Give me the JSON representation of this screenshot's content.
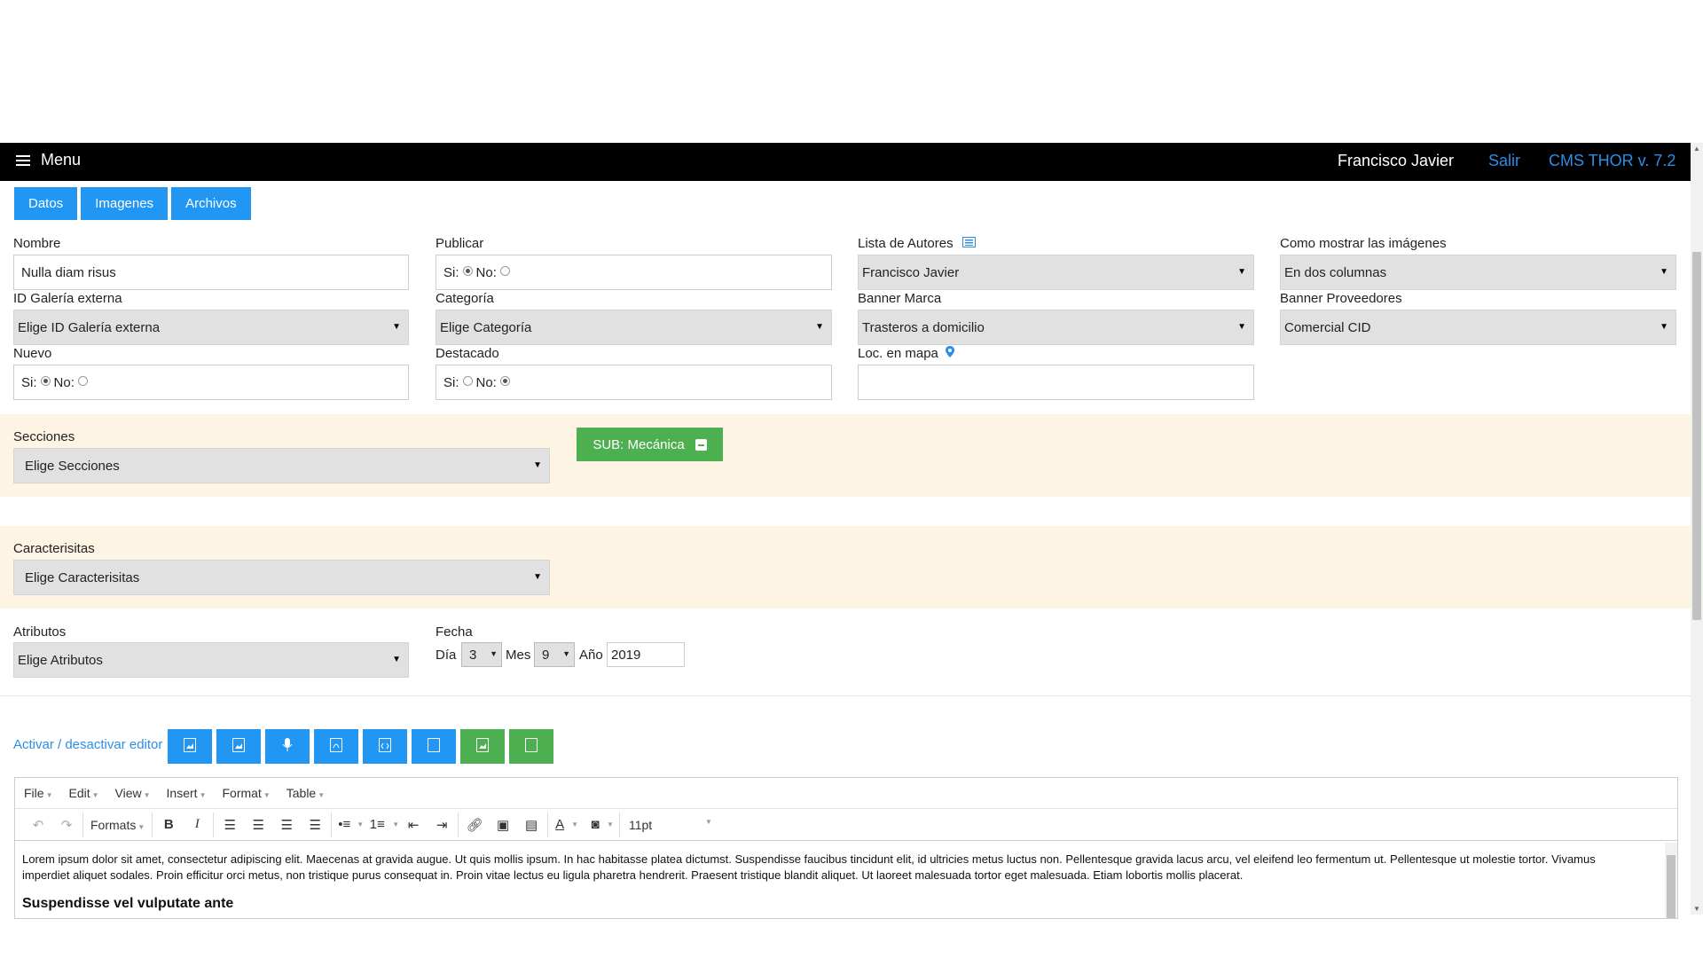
{
  "header": {
    "menu_label": "Menu",
    "user": "Francisco Javier",
    "logout": "Salir",
    "version": "CMS THOR v. 7.2"
  },
  "tabs": [
    "Datos",
    "Imagenes",
    "Archivos"
  ],
  "form": {
    "nombre": {
      "label": "Nombre",
      "value": "Nulla diam risus"
    },
    "publicar": {
      "label": "Publicar",
      "yes": "Si:",
      "no": "No:",
      "selected": "si"
    },
    "autores": {
      "label": "Lista de Autores",
      "value": "Francisco Javier"
    },
    "mostrar_imagenes": {
      "label": "Como mostrar las imágenes",
      "value": "En dos columnas"
    },
    "galeria": {
      "label": "ID Galería externa",
      "value": "Elige ID Galería externa"
    },
    "categoria": {
      "label": "Categoría",
      "value": "Elige Categoría"
    },
    "banner_marca": {
      "label": "Banner Marca",
      "value": "Trasteros a domicilio"
    },
    "banner_proveedores": {
      "label": "Banner Proveedores",
      "value": "Comercial CID"
    },
    "nuevo": {
      "label": "Nuevo",
      "yes": "Si:",
      "no": "No:",
      "selected": "si"
    },
    "destacado": {
      "label": "Destacado",
      "yes": "Si:",
      "no": "No:",
      "selected": "no"
    },
    "mapa": {
      "label": "Loc. en mapa",
      "value": ""
    },
    "secciones": {
      "label": "Secciones",
      "value": "Elige Secciones",
      "chip": "SUB: Mecánica"
    },
    "caracteristicas": {
      "label": "Caracterisitas",
      "value": "Elige Caracterisitas"
    },
    "atributos": {
      "label": "Atributos",
      "value": "Elige Atributos"
    },
    "fecha": {
      "label": "Fecha",
      "dia_label": "Día",
      "dia": "3",
      "mes_label": "Mes",
      "mes": "9",
      "anio_label": "Año",
      "anio": "2019"
    }
  },
  "editor_toggle": "Activar / desactivar editor",
  "file_tools": [
    {
      "icon": "image-file-icon",
      "color": "#2196f3"
    },
    {
      "icon": "image-file-icon",
      "color": "#2196f3"
    },
    {
      "icon": "microphone-icon",
      "color": "#2196f3"
    },
    {
      "icon": "pdf-file-icon",
      "color": "#2196f3"
    },
    {
      "icon": "code-file-icon",
      "color": "#2196f3"
    },
    {
      "icon": "blank-file-icon",
      "color": "#2196f3"
    },
    {
      "icon": "image-file-icon",
      "color": "#4caf50"
    },
    {
      "icon": "blank-file-icon",
      "color": "#4caf50"
    }
  ],
  "editor": {
    "menus": [
      "File",
      "Edit",
      "View",
      "Insert",
      "Format",
      "Table"
    ],
    "formats": "Formats",
    "font_size": "11pt",
    "paragraph": "Lorem ipsum dolor sit amet, consectetur adipiscing elit. Maecenas at gravida augue. Ut quis mollis ipsum. In hac habitasse platea dictumst. Suspendisse faucibus tincidunt elit, id ultricies metus luctus non. Pellentesque gravida lacus arcu, vel eleifend leo fermentum ut. Pellentesque ut molestie tortor. Vivamus imperdiet aliquet sodales. Proin efficitur orci metus, non tristique purus consequat in. Proin vitae lectus eu ligula pharetra hendrerit. Praesent tristique blandit aliquet. Ut laoreet malesuada tortor eget malesuada. Etiam lobortis mollis placerat.",
    "heading": "Suspendisse vel vulputate ante"
  },
  "colors": {
    "accent": "#2196f3",
    "green": "#4caf50",
    "band": "#fdf4e4",
    "bar": "#000000",
    "link": "#2b8ee8"
  }
}
